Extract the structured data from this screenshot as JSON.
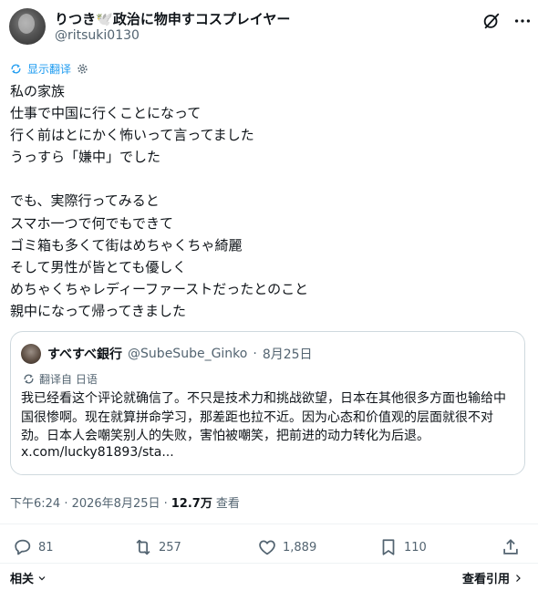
{
  "tweet": {
    "display_name": "りつき🕊️政治に物申すコスプレイヤー",
    "handle": "@ritsuki0130",
    "translate_label": "显示翻译",
    "body": "私の家族\n仕事で中国に行くことになって\n行く前はとにかく怖いって言ってました\nうっすら「嫌中」でした\n\nでも、実際行ってみると\nスマホ一つで何でもできて\nゴミ箱も多くて街はめちゃくちゃ綺麗\nそして男性が皆とても優しく\nめちゃくちゃレディーファーストだったとのこと\n親中になって帰ってきました",
    "timestamp": "下午6:24 · 2026年8月25日 ·",
    "views_count": "12.7万",
    "views_label": "查看"
  },
  "quote": {
    "display_name": "すべすべ銀行",
    "handle": "@SubeSube_Ginko",
    "separator": "·",
    "date": "8月25日",
    "translated_from": "翻译自 日语",
    "text": "我已经看这个评论就确信了。不只是技术力和挑战欲望，日本在其他很多方面也输给中国很惨啊。现在就算拼命学习，那差距也拉不近。因为心态和价值观的层面就很不对劲。日本人会嘲笑别人的失败，害怕被嘲笑，把前进的动力转化为后退。",
    "link": "x.com/lucky81893/sta..."
  },
  "actions": {
    "reply_count": "81",
    "retweet_count": "257",
    "like_count": "1,889",
    "bookmark_count": "110"
  },
  "footer": {
    "related_label": "相关",
    "quotes_label": "查看引用"
  },
  "icons": {
    "header": [
      "grok-icon",
      "more-icon"
    ],
    "actions": [
      "reply-icon",
      "retweet-icon",
      "like-icon",
      "bookmark-icon",
      "share-icon"
    ],
    "misc": [
      "translate-icon",
      "settings-gear-icon",
      "chevron-down-icon",
      "chevron-right-icon"
    ]
  },
  "colors": {
    "link": "#1d9bf0",
    "secondary": "#536471",
    "border": "#cfd9de",
    "text": "#0f1419"
  }
}
